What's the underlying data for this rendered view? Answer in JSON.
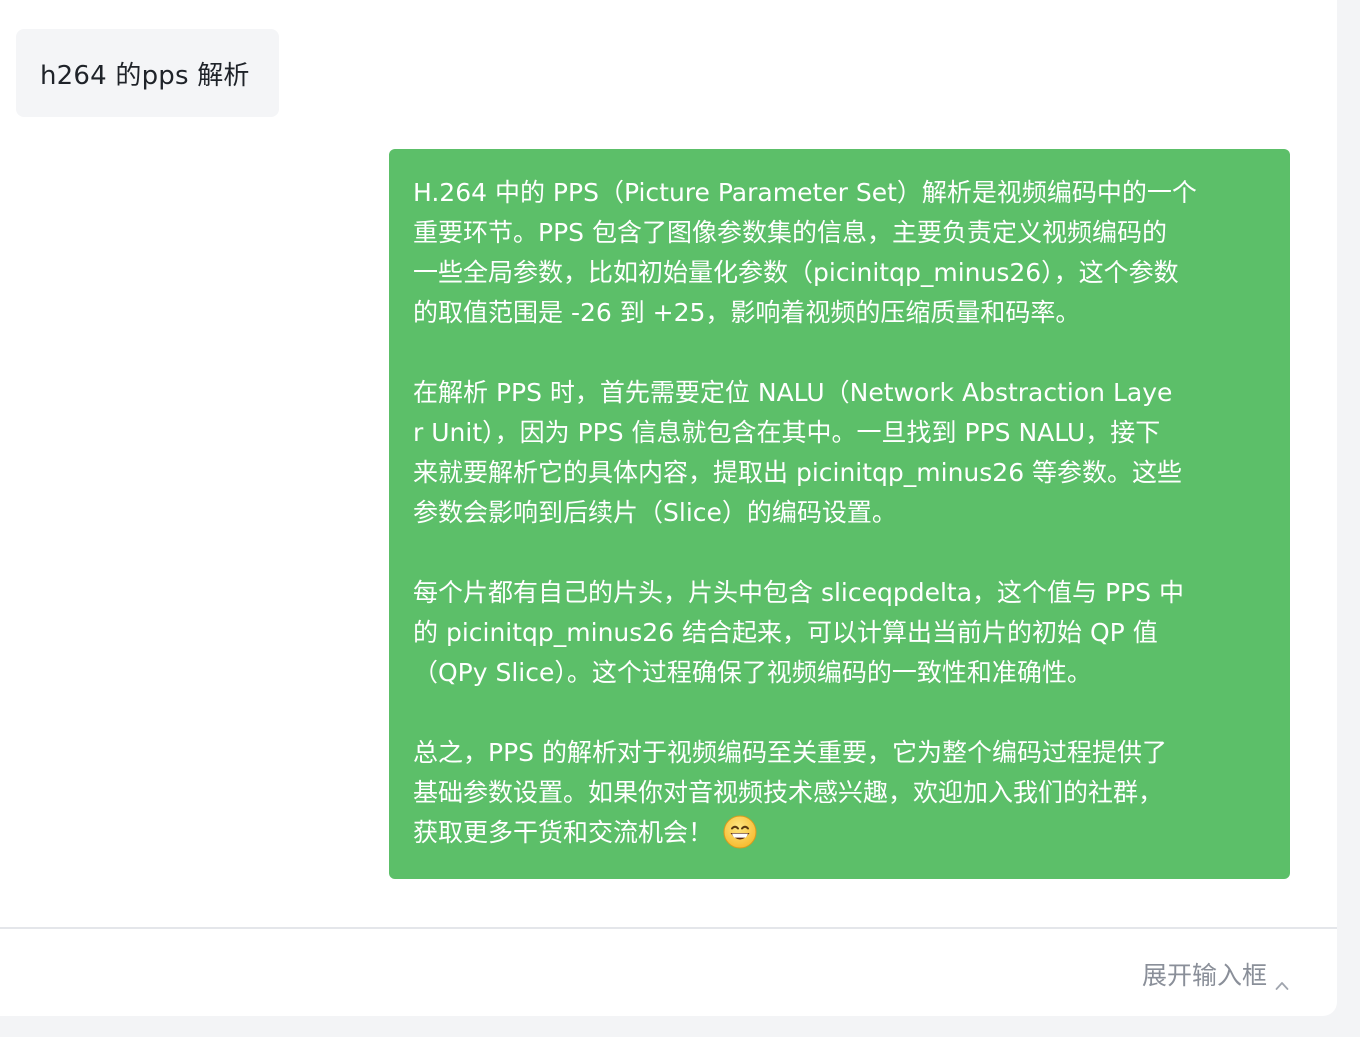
{
  "conversation": {
    "user_message": "h264 的pps 解析",
    "assistant_message": {
      "paragraphs": [
        "H.264 中的 PPS（Picture Parameter Set）解析是视频编码中的一个\n重要环节。PPS 包含了图像参数集的信息，主要负责定义视频编码的\n一些全局参数，比如初始量化参数（picinitqp_minus26），这个参数\n的取值范围是 -26 到 +25，影响着视频的压缩质量和码率。",
        "在解析 PPS 时，首先需要定位 NALU（Network Abstraction Laye\nr Unit），因为 PPS 信息就包含在其中。一旦找到 PPS NALU，接下\n来就要解析它的具体内容，提取出 picinitqp_minus26 等参数。这些\n参数会影响到后续片（Slice）的编码设置。",
        "每个片都有自己的片头，片头中包含 sliceqpdelta，这个值与 PPS 中\n的 picinitqp_minus26 结合起来，可以计算出当前片的初始 QP 值\n（QPy Slice）。这个过程确保了视频编码的一致性和准确性。",
        "总之，PPS 的解析对于视频编码至关重要，它为整个编码过程提供了\n基础参数设置。如果你对音视频技术感兴趣，欢迎加入我们的社群，\n获取更多干货和交流机会！"
      ],
      "trailing_icon": "grinning-face-emoji"
    }
  },
  "input_bar": {
    "expand_label": "展开输入框",
    "icon": "chevron-up-icon"
  },
  "colors": {
    "assistant_bubble": "#5cbf69",
    "user_bubble": "#f4f5f7",
    "page_background": "#f3f4f6",
    "muted_text": "#8a8f99"
  }
}
